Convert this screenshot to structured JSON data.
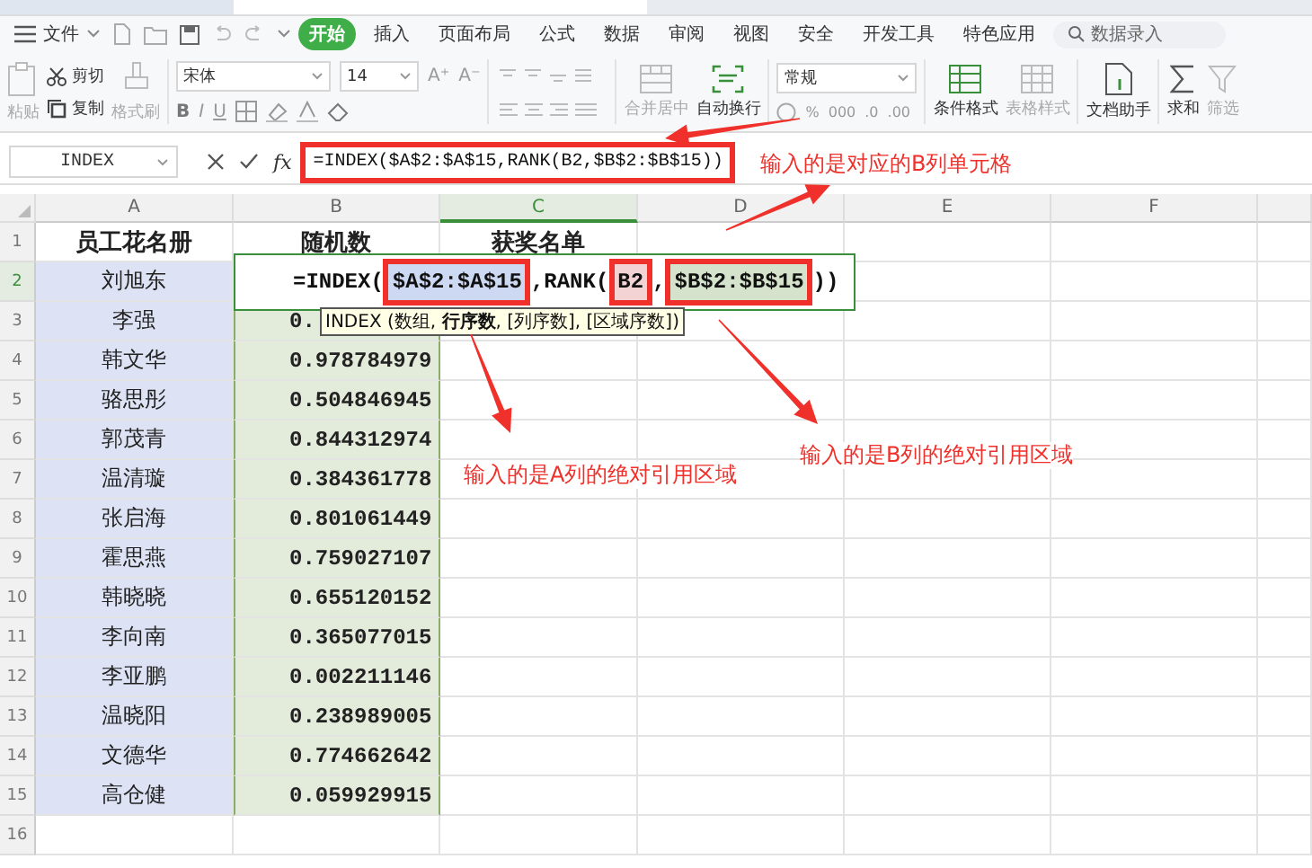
{
  "menu": {
    "file": "文件",
    "tabs": [
      {
        "label": "开始",
        "selected": true
      },
      {
        "label": "插入",
        "selected": false
      },
      {
        "label": "页面布局",
        "selected": false
      },
      {
        "label": "公式",
        "selected": false
      },
      {
        "label": "数据",
        "selected": false
      },
      {
        "label": "审阅",
        "selected": false
      },
      {
        "label": "视图",
        "selected": false
      },
      {
        "label": "安全",
        "selected": false
      },
      {
        "label": "开发工具",
        "selected": false
      },
      {
        "label": "特色应用",
        "selected": false
      }
    ],
    "search": {
      "placeholder": "数据录入"
    }
  },
  "ribbon": {
    "paste": {
      "label": "粘贴",
      "disabled": true
    },
    "cut": {
      "label": "剪切",
      "disabled": false
    },
    "copy": {
      "label": "复制",
      "disabled": false
    },
    "format_painter": {
      "label": "格式刷",
      "disabled": true
    },
    "font": "宋体",
    "font_size": "14",
    "font_grow": "A⁺",
    "font_shrink": "A⁻",
    "font_styles": [
      "B",
      "I",
      "U"
    ],
    "merge": {
      "label": "合并居中",
      "disabled": true
    },
    "wrap": {
      "label": "自动换行",
      "disabled": false
    },
    "number_format": "常规",
    "number_buttons": [
      "%",
      "000",
      ".0",
      ".00"
    ],
    "conditional": {
      "label": "条件格式",
      "disabled": false
    },
    "table_style": {
      "label": "表格样式",
      "disabled": true
    },
    "doc_helper": {
      "label": "文档助手",
      "disabled": false
    },
    "sum": {
      "label": "求和",
      "disabled": false
    },
    "filter": {
      "label": "筛选",
      "disabled": true
    }
  },
  "formula_bar": {
    "name_box": "INDEX",
    "fx": "fx",
    "formula": "=INDEX($A$2:$A$15,RANK(B2,$B$2:$B$15))",
    "boxed": true
  },
  "sheet": {
    "columns": [
      {
        "label": "A",
        "selected": false
      },
      {
        "label": "B",
        "selected": false
      },
      {
        "label": "C",
        "selected": true
      },
      {
        "label": "D",
        "selected": false
      },
      {
        "label": "E",
        "selected": false
      },
      {
        "label": "F",
        "selected": false
      }
    ],
    "rows": [
      {
        "number": "1",
        "selected": false,
        "kind": "header",
        "cells": [
          "员工花名册",
          "随机数",
          "获奖名单"
        ]
      },
      {
        "number": "2",
        "selected": true,
        "kind": "data",
        "cells": [
          "刘旭东"
        ]
      },
      {
        "number": "3",
        "selected": false,
        "kind": "data",
        "cells": [
          "李强",
          "0."
        ]
      },
      {
        "number": "4",
        "selected": false,
        "kind": "data",
        "cells": [
          "韩文华",
          "0.978784979"
        ]
      },
      {
        "number": "5",
        "selected": false,
        "kind": "data",
        "cells": [
          "骆思彤",
          "0.504846945"
        ]
      },
      {
        "number": "6",
        "selected": false,
        "kind": "data",
        "cells": [
          "郭茂青",
          "0.844312974"
        ]
      },
      {
        "number": "7",
        "selected": false,
        "kind": "data",
        "cells": [
          "温清璇",
          "0.384361778"
        ]
      },
      {
        "number": "8",
        "selected": false,
        "kind": "data",
        "cells": [
          "张启海",
          "0.801061449"
        ]
      },
      {
        "number": "9",
        "selected": false,
        "kind": "data",
        "cells": [
          "霍思燕",
          "0.759027107"
        ]
      },
      {
        "number": "10",
        "selected": false,
        "kind": "data",
        "cells": [
          "韩晓晓",
          "0.655120152"
        ]
      },
      {
        "number": "11",
        "selected": false,
        "kind": "data",
        "cells": [
          "李向南",
          "0.365077015"
        ]
      },
      {
        "number": "12",
        "selected": false,
        "kind": "data",
        "cells": [
          "李亚鹏",
          "0.002211146"
        ]
      },
      {
        "number": "13",
        "selected": false,
        "kind": "data",
        "cells": [
          "温晓阳",
          "0.238989005"
        ]
      },
      {
        "number": "14",
        "selected": false,
        "kind": "data",
        "cells": [
          "文德华",
          "0.774662642"
        ]
      },
      {
        "number": "15",
        "selected": false,
        "kind": "data",
        "cells": [
          "高仓健",
          "0.059929915"
        ]
      },
      {
        "number": "16",
        "selected": false,
        "kind": "empty",
        "cells": []
      }
    ]
  },
  "editing": {
    "parts": [
      {
        "text": "=INDEX("
      },
      {
        "text": "$A$2:$A$15",
        "color": "#cdd9f2",
        "boxed": true
      },
      {
        "text": ",RANK("
      },
      {
        "text": "B2",
        "color": "#f3d3d3",
        "boxed": true
      },
      {
        "text": ","
      },
      {
        "text": "$B$2:$B$15",
        "color": "#d5e3cc",
        "boxed": true
      },
      {
        "text": "))"
      }
    ],
    "tooltip": "INDEX (数组, **行序数**, [列序数], [区域序数])"
  },
  "annotations": [
    {
      "text": "输入的是对应的B列单元格"
    },
    {
      "text": "输入的是B列的绝对引用区域"
    },
    {
      "text": "输入的是A列的绝对引用区域"
    }
  ]
}
